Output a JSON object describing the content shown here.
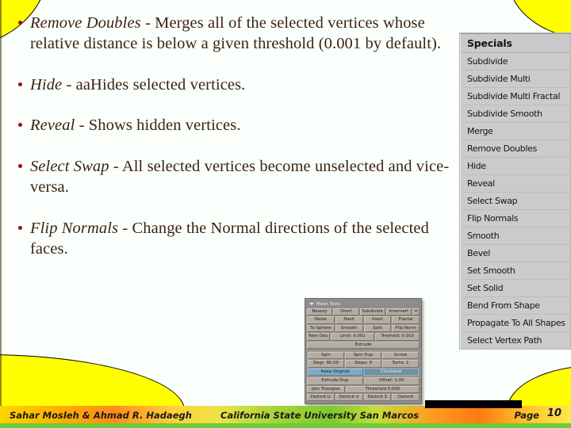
{
  "slide": {
    "background_color": "#fbfffb",
    "accent_color": "#ffff00",
    "text_color": "#3a2410",
    "bullet_color": "#9e0b0b"
  },
  "bullets": [
    {
      "term": "Remove Doubles",
      "separator": " - ",
      "description": "Merges all of the selected vertices whose relative distance is below a given threshold (0.001 by default)."
    },
    {
      "term": "Hide",
      "separator": " - ",
      "description": "aaHides selected vertices."
    },
    {
      "term": "Reveal",
      "separator": " - ",
      "description": "Shows hidden vertices."
    },
    {
      "term": "Select Swap",
      "separator": " - ",
      "description": "All selected vertices become unselected and vice-versa."
    },
    {
      "term": "Flip Normals",
      "separator": " - ",
      "description": "Change the Normal directions of the selected faces."
    }
  ],
  "specials_menu": {
    "header": "Specials",
    "items": [
      "Subdivide",
      "Subdivide Multi",
      "Subdivide Multi Fractal",
      "Subdivide Smooth",
      "Merge",
      "Remove Doubles",
      "Hide",
      "Reveal",
      "Select Swap",
      "Flip Normals",
      "Smooth",
      "Bevel",
      "Set Smooth",
      "Set Solid",
      "Bend From Shape",
      "Propagate To All Shapes",
      "Select Vertex Path"
    ]
  },
  "mesh_tools_panel": {
    "title": "Mesh Tools",
    "rows": [
      [
        "Beauty",
        "Short",
        "Subdivide",
        "Innervert",
        "="
      ],
      [
        "Noise",
        "Hash",
        "Xsort",
        "Fractal"
      ],
      [
        "To Sphere",
        "Smooth",
        "Split",
        "Flip Norm"
      ],
      [
        "Rem Dou",
        "Limit: 0.001",
        "Treshold: 0.010"
      ],
      [
        "Extrude"
      ],
      [
        "Spin",
        "Spin Dup",
        "Screw"
      ],
      [
        "Degr: 90.00",
        "Steps: 9",
        "Turns: 1"
      ],
      [
        "Keep Original",
        "Clockwise"
      ],
      [
        "Extrude Dup",
        "Offset: 1.00"
      ],
      [
        "Join Triangles",
        "Threshold 0.000"
      ],
      [
        "Delimit U",
        "Delimit V",
        "Delimit S",
        "Delimit"
      ]
    ]
  },
  "footer": {
    "authors": "Sahar Mosleh & Ahmad R. Hadaegh",
    "university": "California State University San Marcos",
    "page_label": "Page",
    "page_number": "10"
  }
}
